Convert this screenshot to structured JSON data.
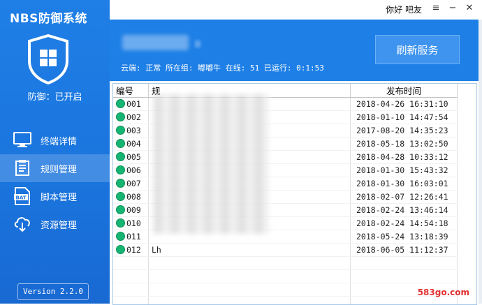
{
  "app": {
    "title": "NBS防御系统",
    "defense_status": "防御：已开启",
    "version": "Version 2.2.0"
  },
  "sidebar": {
    "items": [
      {
        "label": "终端详情",
        "icon": "monitor-icon",
        "active": false
      },
      {
        "label": "规则管理",
        "icon": "rules-icon",
        "active": true
      },
      {
        "label": "脚本管理",
        "icon": "bat-script-icon",
        "active": false
      },
      {
        "label": "资源管理",
        "icon": "cloud-download-icon",
        "active": false
      }
    ]
  },
  "topbar": {
    "greeting": "你好 吧友",
    "menu_icon": "≡",
    "minimize_icon": "−",
    "close_icon": "✕"
  },
  "header": {
    "status_line": "云端: 正常 所在组: 嘟嘟牛 在线: 51 已运行: 0:1:53",
    "refresh_label": "刷新服务"
  },
  "table": {
    "columns": [
      "编号",
      "规",
      "发布时间"
    ],
    "rows": [
      {
        "no": "001",
        "name": "",
        "time": "2018-04-26 16:31:10"
      },
      {
        "no": "002",
        "name": "",
        "time": "2018-01-10 14:47:54"
      },
      {
        "no": "003",
        "name": "",
        "time": "2017-08-20 14:35:23"
      },
      {
        "no": "004",
        "name": "",
        "time": "2018-05-18 13:02:50"
      },
      {
        "no": "005",
        "name": "",
        "time": "2018-04-28 10:33:12"
      },
      {
        "no": "006",
        "name": "",
        "time": "2018-01-30 15:43:32"
      },
      {
        "no": "007",
        "name": "",
        "time": "2018-01-30 16:03:01"
      },
      {
        "no": "008",
        "name": "",
        "time": "2018-02-07 12:26:41"
      },
      {
        "no": "009",
        "name": "",
        "time": "2018-02-24 13:46:14"
      },
      {
        "no": "010",
        "name": "",
        "time": "2018-02-24 14:54:18"
      },
      {
        "no": "011",
        "name": "",
        "time": "2018-05-24 13:18:39"
      },
      {
        "no": "012",
        "name": "Lh",
        "time": "2018-06-05 11:12:37"
      }
    ]
  },
  "watermark": "583go.com",
  "colors": {
    "sidebar_blue": "#1a74dd",
    "header_blue": "#1e7fe6",
    "status_green": "#17b573"
  }
}
